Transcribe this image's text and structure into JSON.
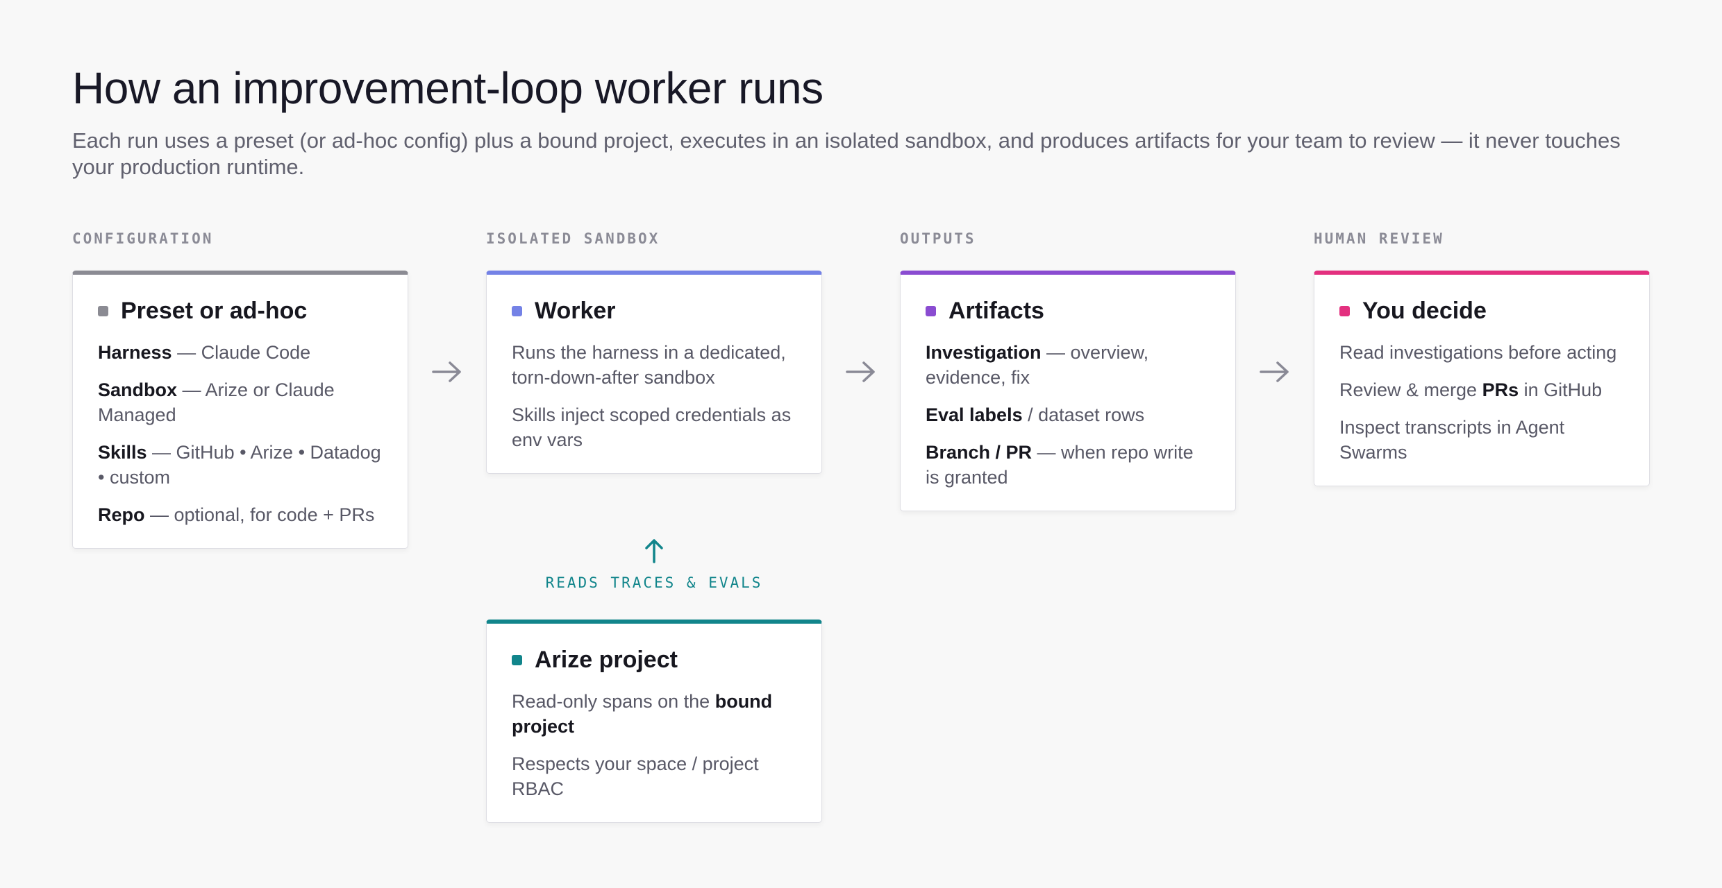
{
  "header": {
    "title": "How an improvement-loop worker runs",
    "subtitle": "Each run uses a preset (or ad-hoc config) plus a bound project, executes in an isolated sandbox, and produces artifacts for your team to review — it never touches your production runtime."
  },
  "columns": [
    {
      "label": "CONFIGURATION",
      "card": {
        "title": "Preset or ad-hoc",
        "accent": "#8b8b93",
        "lines": [
          {
            "bold": "Harness",
            "text": " — Claude Code"
          },
          {
            "bold": "Sandbox",
            "text": " — Arize or Claude Managed"
          },
          {
            "bold": "Skills",
            "text": " — GitHub • Arize • Datadog • custom"
          },
          {
            "bold": "Repo",
            "text": " — optional, for code + PRs"
          }
        ]
      }
    },
    {
      "label": "ISOLATED SANDBOX",
      "card": {
        "title": "Worker",
        "accent": "#7482e6",
        "lines": [
          {
            "text": "Runs the harness in a dedicated, torn-down-after sandbox"
          },
          {
            "text": "Skills inject scoped credentials as env vars"
          }
        ]
      }
    },
    {
      "label": "OUTPUTS",
      "card": {
        "title": "Artifacts",
        "accent": "#8a4cd1",
        "lines": [
          {
            "bold": "Investigation",
            "text": " — overview, evidence, fix"
          },
          {
            "bold": "Eval labels",
            "text": " / dataset rows"
          },
          {
            "bold": "Branch / PR",
            "text": " — when repo write is granted"
          }
        ]
      }
    },
    {
      "label": "HUMAN REVIEW",
      "card": {
        "title": "You decide",
        "accent": "#e3307f",
        "lines": [
          {
            "text": "Read investigations before acting"
          },
          {
            "pre": "Review & merge ",
            "bold": "PRs",
            "text": " in GitHub"
          },
          {
            "text": "Inspect transcripts in Agent Swarms"
          }
        ]
      }
    }
  ],
  "connector": {
    "label": "READS TRACES & EVALS",
    "accent": "#11858b"
  },
  "project_card": {
    "title": "Arize project",
    "accent": "#11858b",
    "lines": [
      {
        "pre": "Read-only spans on the ",
        "bold": "bound project",
        "text": ""
      },
      {
        "text": "Respects your space / project RBAC"
      }
    ]
  },
  "icons": {
    "flow_arrow": "arrow-right-icon",
    "up_arrow": "arrow-up-icon"
  }
}
